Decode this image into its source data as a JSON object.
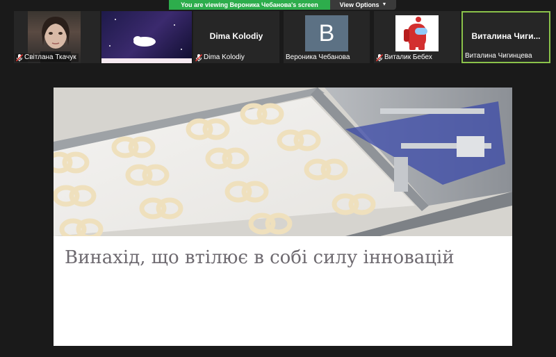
{
  "banner": {
    "viewing_text": "You are viewing Вероника Чебанова's screen",
    "view_options_label": "View Options"
  },
  "participants": [
    {
      "name": "Світлана Ткачук",
      "muted": true,
      "type": "video"
    },
    {
      "name": "",
      "muted": false,
      "type": "image"
    },
    {
      "name": "Dima Kolodiy",
      "muted": true,
      "type": "name-only",
      "display_name": "Dima Kolodiy"
    },
    {
      "name": "Вероника Чебанова",
      "muted": false,
      "type": "avatar",
      "initial": "B"
    },
    {
      "name": "Виталик Бебех",
      "muted": true,
      "type": "avatar-image"
    },
    {
      "name": "Виталина Чигинцева",
      "muted": false,
      "type": "name-only",
      "display_name": "Виталина  Чиги..."
    }
  ],
  "slide": {
    "title": "Винахід, що втілює в собі силу інновацій"
  },
  "colors": {
    "banner_green": "#2dad4c",
    "active_speaker": "#8bc34a",
    "background": "#1a1a1a",
    "title_text": "#6e6a70"
  }
}
